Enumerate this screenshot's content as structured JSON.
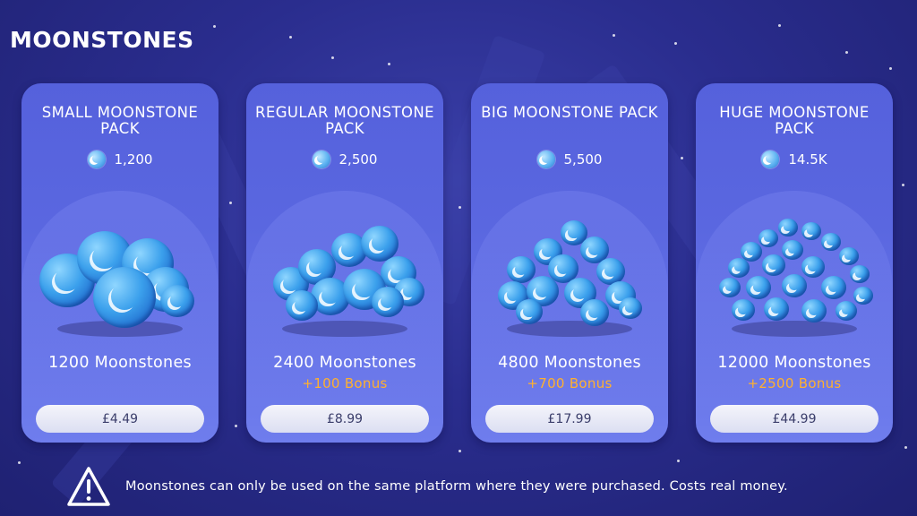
{
  "page": {
    "title": "MOONSTONES"
  },
  "packs": [
    {
      "name": "SMALL MOONSTONE PACK",
      "currency_amount": "1,200",
      "moonstones": "1200 Moonstones",
      "bonus": "",
      "price": "£4.49"
    },
    {
      "name": "REGULAR MOONSTONE PACK",
      "currency_amount": "2,500",
      "moonstones": "2400 Moonstones",
      "bonus": "+100 Bonus",
      "price": "£8.99"
    },
    {
      "name": "BIG MOONSTONE PACK",
      "currency_amount": "5,500",
      "moonstones": "4800 Moonstones",
      "bonus": "+700 Bonus",
      "price": "£17.99"
    },
    {
      "name": "HUGE MOONSTONE PACK",
      "currency_amount": "14.5K",
      "moonstones": "12000 Moonstones",
      "bonus": "+2500 Bonus",
      "price": "£44.99"
    }
  ],
  "notice": {
    "text": "Moonstones can only be used on the same platform where they were purchased. Costs real money.",
    "icon": "warning-icon"
  },
  "colors": {
    "background": "#2a2d8e",
    "card": "#5a67e0",
    "bonus": "#ffb02e",
    "button": "#e8e9f6"
  },
  "icons": {
    "currency": "moon-icon"
  }
}
